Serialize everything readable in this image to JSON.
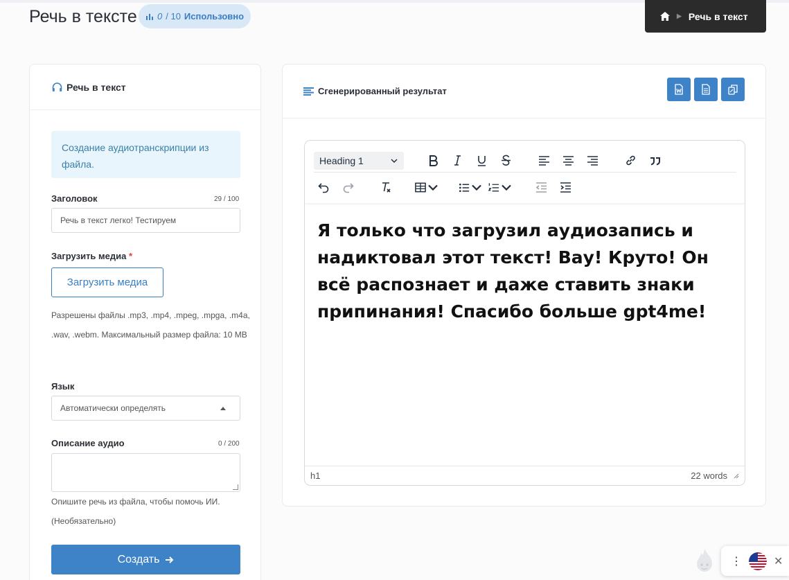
{
  "header": {
    "title": "Речь в тексте",
    "usage_used": "0",
    "usage_total": "/ 10",
    "usage_label": "Использовно"
  },
  "breadcrumb": {
    "current": "Речь в текст"
  },
  "left_panel": {
    "title": "Речь в текст",
    "info": "Создание аудиотранскрипции из файла.",
    "title_field": {
      "label": "Заголовок",
      "counter": "29 / 100",
      "value": "Речь в текст легко! Тестируем"
    },
    "upload": {
      "label": "Загрузить медиа",
      "required_mark": "*",
      "button": "Загрузить медиа",
      "help": "Разрешены файлы .mp3, .mp4, .mpeg, .mpga, .m4a, .wav, .webm. Максимальный размер файла: 10 MB"
    },
    "language": {
      "label": "Язык",
      "value": "Автоматически определять"
    },
    "description": {
      "label": "Описание аудио",
      "counter": "0 / 200",
      "help": "Опишите речь из файла, чтобы помочь ИИ. (Необязательно)"
    },
    "submit": "Создать"
  },
  "right_panel": {
    "title": "Сгенерированный результат",
    "editor": {
      "block_format": "Heading 1",
      "content": "Я только что загрузил аудиозапись и надиктовал этот текст! Вау! Круто! Он всё распознает и даже ставить знаки припинания! Спасибо больше gpt4me!",
      "status_path": "h1",
      "word_count": "22 words"
    }
  },
  "colors": {
    "accent": "#3e82c8",
    "dark": "#2b2b2b",
    "info_bg": "#e8f5fc"
  }
}
